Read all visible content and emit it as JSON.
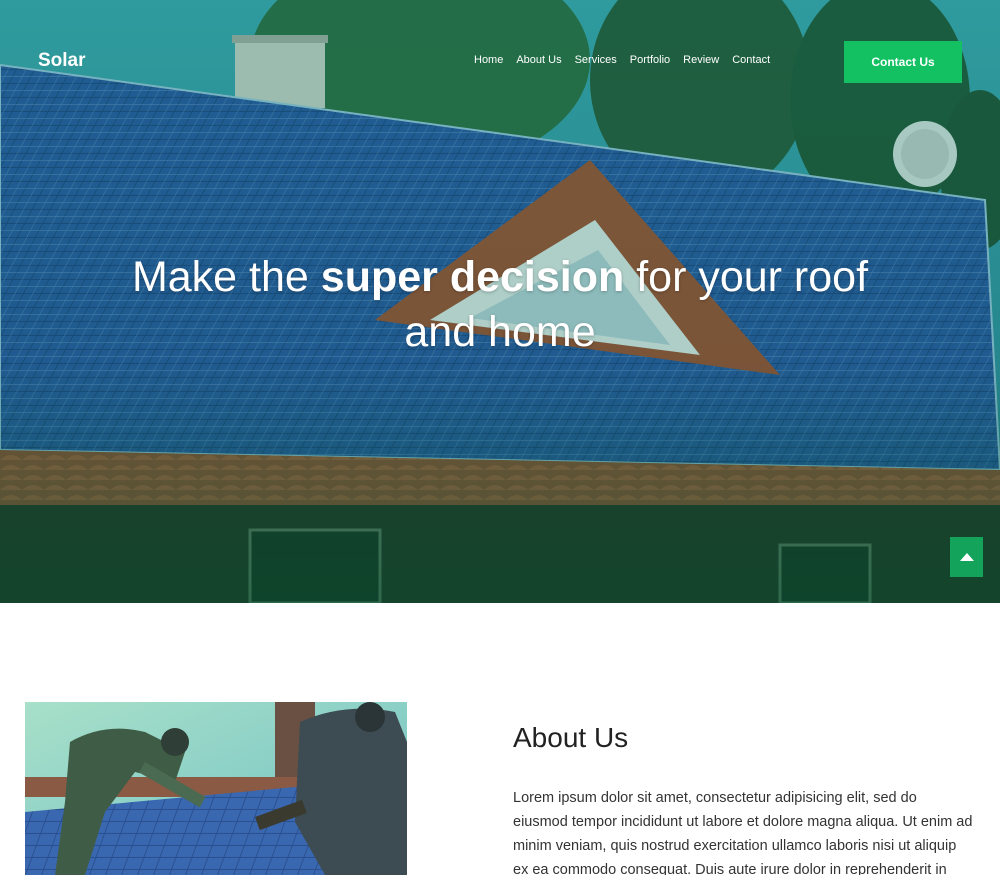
{
  "header": {
    "brand": "Solar",
    "nav": [
      {
        "label": "Home"
      },
      {
        "label": "About Us"
      },
      {
        "label": "Services"
      },
      {
        "label": "Portfolio"
      },
      {
        "label": "Review"
      },
      {
        "label": "Contact"
      }
    ],
    "cta_label": "Contact Us"
  },
  "hero": {
    "title_pre": "Make the ",
    "title_bold": "super decision",
    "title_post": " for your roof and home"
  },
  "about": {
    "title": "About Us",
    "text": "Lorem ipsum dolor sit amet, consectetur adipisicing elit, sed do eiusmod tempor incididunt ut labore et dolore magna aliqua. Ut enim ad minim veniam, quis nostrud exercitation ullamco laboris nisi ut aliquip ex ea commodo consequat. Duis aute irure dolor in reprehenderit in voluptate velit esse cillum dolore"
  },
  "colors": {
    "accent": "#13c163",
    "hero_overlay": "#0a6b4a",
    "text": "#222222"
  },
  "icons": {
    "scroll_top": "chevron-up-icon"
  }
}
